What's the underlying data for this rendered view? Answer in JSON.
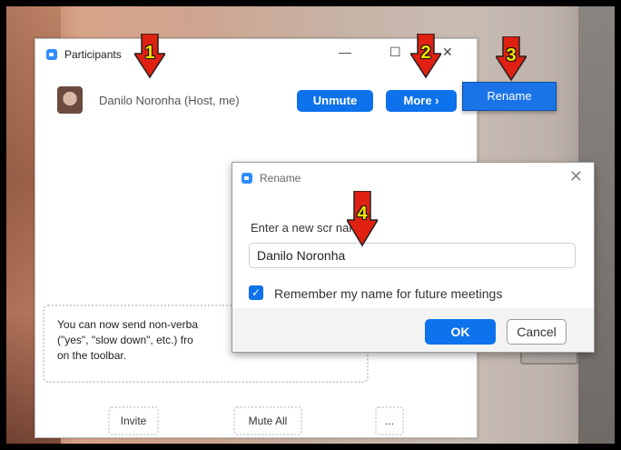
{
  "participants_window": {
    "title": "Participants",
    "minimize_glyph": "—",
    "maximize_glyph": "☐",
    "close_glyph": "✕",
    "participant_name": "Danilo Noronha (Host, me)",
    "unmute_label": "Unmute",
    "more_label": "More ›",
    "rename_menu_label": "Rename",
    "tip_text": "You can now send non-verba (\"yes\", \"slow down\", etc.) fro on the toolbar.",
    "tip_line1": "You can now send non-verba",
    "tip_line2": "(\"yes\", \"slow down\", etc.) fro",
    "tip_line3": "on the toolbar.",
    "invite_label": "Invite",
    "mute_all_label": "Mute All",
    "more_options_label": "..."
  },
  "rename_dialog": {
    "title": "Rename",
    "close_glyph": "✕",
    "prompt_label": "Enter a new scr   name:",
    "name_value": "Danilo Noronha",
    "remember_label": "Remember my name for future meetings",
    "remember_checked": true,
    "ok_label": "OK",
    "cancel_label": "Cancel"
  },
  "annotations": [
    {
      "number": "1"
    },
    {
      "number": "2"
    },
    {
      "number": "3"
    },
    {
      "number": "4"
    }
  ],
  "colors": {
    "zoom_blue": "#0e72ed",
    "arrow_red": "#e02010",
    "number_yellow": "#f4e400"
  }
}
